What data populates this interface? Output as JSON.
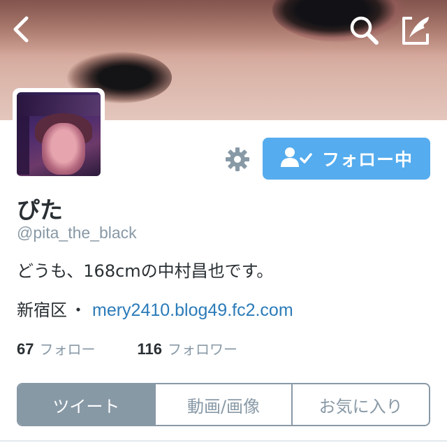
{
  "profile": {
    "name": "ぴた",
    "handle": "@pita_the_black",
    "bio": "どうも、168cmの中村昌也です。",
    "location": "新宿区",
    "separator": "・",
    "url": "mery2410.blog49.fc2.com"
  },
  "actions": {
    "follow_label": "フォロー中",
    "icons": [
      "back-arrow-icon",
      "search-icon",
      "compose-icon",
      "gear-icon",
      "person-check-icon"
    ]
  },
  "stats": {
    "following_count": "67",
    "following_label": "フォロー",
    "followers_count": "116",
    "followers_label": "フォロワー"
  },
  "tabs": [
    {
      "label": "ツイート",
      "active": true
    },
    {
      "label": "動画/画像",
      "active": false
    },
    {
      "label": "お気に入り",
      "active": false
    }
  ],
  "colors": {
    "accent": "#55acee",
    "link": "#2b7bb9",
    "muted": "#8899a6",
    "text": "#292f33"
  }
}
